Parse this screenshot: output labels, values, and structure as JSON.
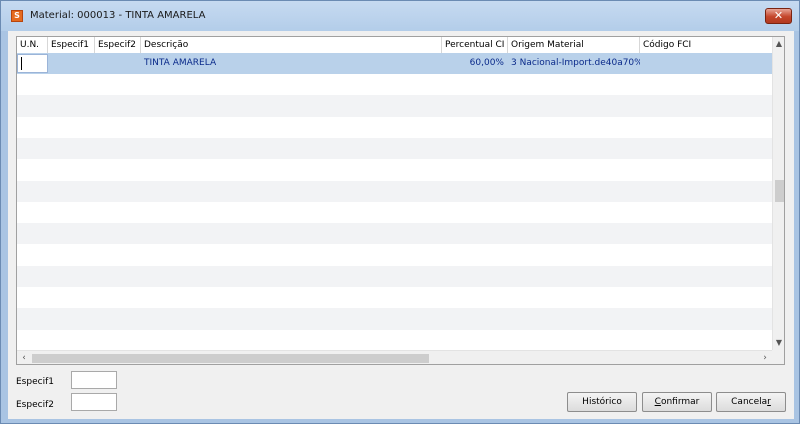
{
  "window": {
    "icon": "app-icon",
    "title": "Material: 000013 - TINTA AMARELA",
    "close_label": "✕"
  },
  "grid": {
    "columns": [
      "U.N.",
      "Especif1",
      "Especif2",
      "Descrição",
      "Percentual CI",
      "Origem Material",
      "Código FCI"
    ],
    "rows": [
      {
        "un": "",
        "especif1": "",
        "especif2": "",
        "descricao": "TINTA AMARELA",
        "percentual_ci": "60,00%",
        "origem_material": "3 Nacional-Import.de40a70%",
        "codigo_fci": ""
      }
    ],
    "empty_rows": 13
  },
  "form": {
    "especif1_label": "Especif1",
    "especif1_value": "",
    "especif2_label": "Especif2",
    "especif2_value": ""
  },
  "buttons": {
    "historico": "Histórico",
    "confirmar_first": "C",
    "confirmar_rest": "onfirmar",
    "cancelar_main": "Cancela",
    "cancelar_last": "r"
  },
  "colors": {
    "selection": "#b9d1ea",
    "alt_row": "#f2f3f5",
    "close": "#c4452b"
  }
}
